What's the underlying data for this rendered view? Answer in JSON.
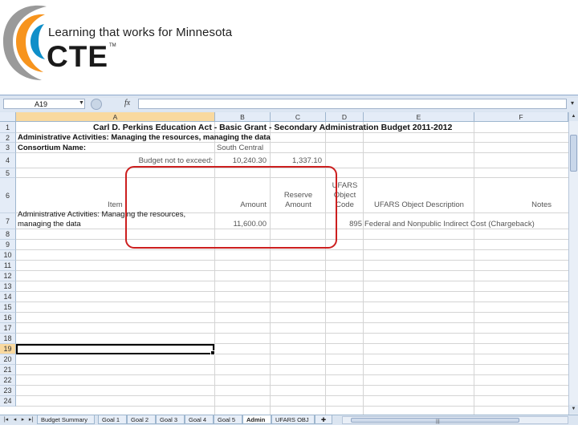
{
  "branding": {
    "tagline": "Learning that works for Minnesota",
    "logo_text": "CTE",
    "trademark": "TM",
    "colors": {
      "swoosh_orange": "#f7941d",
      "swoosh_blue": "#0f8fc9",
      "swoosh_gray": "#9a9a9a"
    }
  },
  "formula_bar": {
    "name_box": "A19",
    "fx_label": "fx",
    "formula_value": ""
  },
  "columns": [
    "A",
    "B",
    "C",
    "D",
    "E",
    "F"
  ],
  "rows": [
    "1",
    "2",
    "3",
    "4",
    "5",
    "6",
    "7",
    "8",
    "9",
    "10",
    "11",
    "12",
    "13",
    "14",
    "15",
    "16",
    "17",
    "18",
    "19",
    "20",
    "21",
    "22",
    "23",
    "24"
  ],
  "cells": {
    "r1_title": "Carl D. Perkins Education Act - Basic Grant - Secondary Administration Budget  2011-2012",
    "r2_subtitle": "Administrative Activities: Managing the resources, managing the data",
    "r3_consortium_label": "Consortium Name:",
    "r3_consortium_value": "South Central",
    "r4_budget_label": "Budget not to exceed:",
    "r4_budget_amount": "10,240.30",
    "r4_reserve_amount": "1,337.10",
    "r6_item": "Item",
    "r6_amount": "Amount",
    "r6_reserve_line1": "Reserve",
    "r6_reserve_line2": "Amount",
    "r6_ufars_line1": "UFARS",
    "r6_ufars_line2": "Object",
    "r6_ufars_line3": "Code",
    "r6_ufars_desc": "UFARS Object Description",
    "r6_notes": "Notes",
    "r7_item_line1": "Administrative Activities: Managing the resources,",
    "r7_item_line2": "managing the data",
    "r7_amount": "11,600.00",
    "r7_code": "895",
    "r7_desc": "Federal and Nonpublic Indirect Cost (Chargeback)"
  },
  "sheet_tabs": [
    {
      "label": "Budget Summary",
      "active": false
    },
    {
      "label": "Goal 1",
      "active": false
    },
    {
      "label": "Goal 2",
      "active": false
    },
    {
      "label": "Goal 3",
      "active": false
    },
    {
      "label": "Goal 4",
      "active": false
    },
    {
      "label": "Goal 5",
      "active": false
    },
    {
      "label": "Admin",
      "active": true
    },
    {
      "label": "UFARS OBJ",
      "active": false
    }
  ],
  "highlight_color": "#cc1f1f"
}
